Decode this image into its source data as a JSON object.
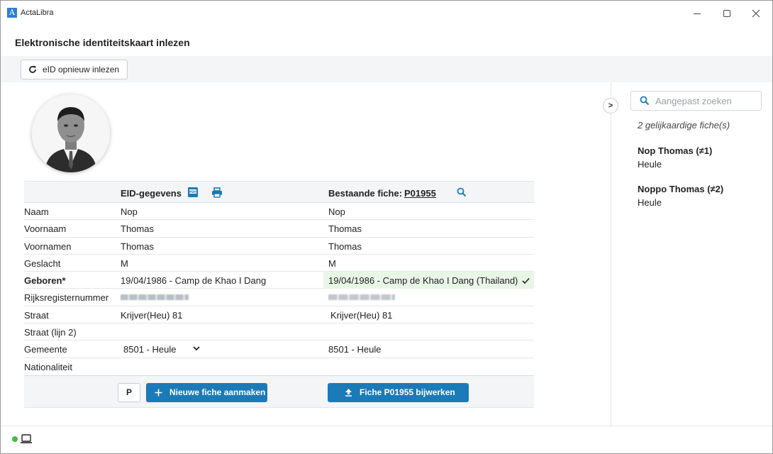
{
  "window": {
    "title": "ActaLibra",
    "logo_letter": "A"
  },
  "header": {
    "title": "Elektronische identiteitskaart inlezen"
  },
  "toolbar": {
    "reread_label": "eID opnieuw inlezen"
  },
  "table": {
    "eid_header": "EID-gegevens",
    "existing_header": "Bestaande fiche:",
    "existing_ref": "P01955",
    "rows": [
      {
        "label": "Naam",
        "eid": "Nop",
        "existing": "Nop"
      },
      {
        "label": "Voornaam",
        "eid": "Thomas",
        "existing": "Thomas"
      },
      {
        "label": "Voornamen",
        "eid": "Thomas",
        "existing": "Thomas"
      },
      {
        "label": "Geslacht",
        "eid": "M",
        "existing": "M"
      },
      {
        "label": "Geboren*",
        "eid": "19/04/1986 - Camp de Khao I Dang",
        "existing": "19/04/1986 - Camp de Khao I Dang (Thailand)"
      },
      {
        "label": "Rijksregisternummer",
        "eid": "",
        "existing": ""
      },
      {
        "label": "Straat",
        "eid": "Krijver(Heu) 81",
        "existing": "Krijver(Heu) 81"
      },
      {
        "label": "Straat (lijn 2)",
        "eid": "",
        "existing": ""
      },
      {
        "label": "Gemeente",
        "eid": "8501 - Heule",
        "existing": "8501 - Heule"
      },
      {
        "label": "Nationaliteit",
        "eid": "",
        "existing": ""
      }
    ],
    "p_button": "P",
    "new_button": "Nieuwe fiche aanmaken",
    "update_button": "Fiche P01955 bijwerken"
  },
  "side": {
    "collapse_label": ">",
    "search_placeholder": "Aangepast zoeken",
    "similar_count": "2 gelijkaardige fiche(s)",
    "similar": [
      {
        "name": "Nop Thomas (≠1)",
        "city": "Heule"
      },
      {
        "name": "Noppo Thomas (≠2)",
        "city": "Heule"
      }
    ]
  },
  "colors": {
    "accent": "#1b7ab8",
    "highlight": "#e8f6e6",
    "status_online": "#3cc13c"
  }
}
